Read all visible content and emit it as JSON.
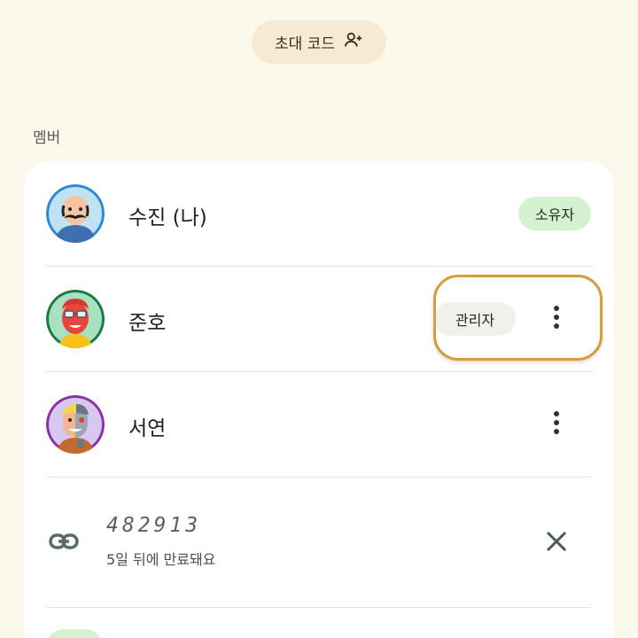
{
  "invite": {
    "label": "초대 코드",
    "icon": "person-add-icon"
  },
  "section": {
    "members_label": "멤버"
  },
  "members": [
    {
      "name": "수진 (나)",
      "role": "소유자",
      "avatar": "bald-mustache-man-avatar",
      "ring_color": "#2f86d4"
    },
    {
      "name": "준호",
      "role": "관리자",
      "avatar": "red-beard-glasses-avatar",
      "ring_color": "#1a7a3c"
    },
    {
      "name": "서연",
      "role": "",
      "avatar": "half-robot-avatar",
      "ring_color": "#8a2fa6"
    }
  ],
  "invite_code": {
    "code": "482913",
    "expires": "5일 뒤에 만료돼요",
    "icon": "link-icon",
    "close_icon": "close-icon"
  },
  "colors": {
    "background": "#fbf8ec",
    "owner_badge": "#d4f2d2",
    "admin_badge": "#f1f0eb",
    "highlight": "#d59c38"
  }
}
